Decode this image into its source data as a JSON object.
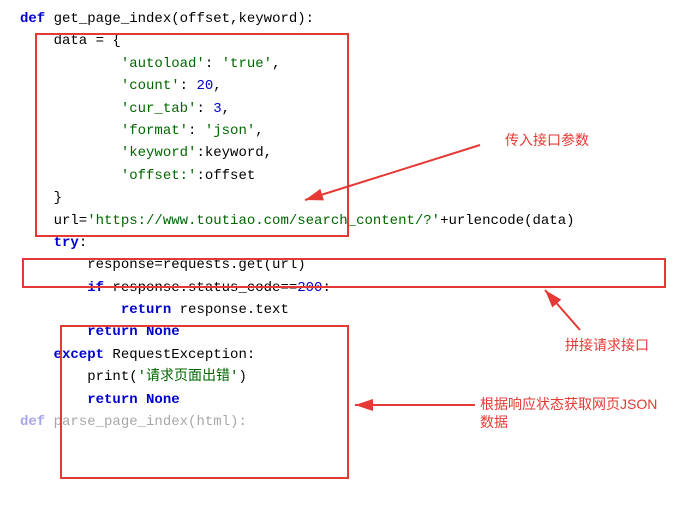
{
  "code": {
    "l1_def": "def",
    "l1_fn": " get_page_index",
    "l1_rest": "(offset,keyword):",
    "l2": "    data = {",
    "l3_k": "            'autoload'",
    "l3_sep": ": ",
    "l3_v": "'true'",
    "l3_end": ",",
    "l4_k": "            'count'",
    "l4_sep": ": ",
    "l4_v": "20",
    "l4_end": ",",
    "l5_k": "            'cur_tab'",
    "l5_sep": ": ",
    "l5_v": "3",
    "l5_end": ",",
    "l6_k": "            'format'",
    "l6_sep": ": ",
    "l6_v": "'json'",
    "l6_end": ",",
    "l7_k": "            'keyword'",
    "l7_rest": ":keyword,",
    "l8_k": "            'offset:'",
    "l8_rest": ":offset",
    "l9": "    }",
    "l10_a": "    url=",
    "l10_b": "'https://www.toutiao.com/search_content/?'",
    "l10_c": "+urlencode(data)",
    "l11_try": "    try",
    "l11_colon": ":",
    "l12": "        response=requests.get(url)",
    "l13_if": "        if",
    "l13_rest": " response.status_code==",
    "l13_num": "200",
    "l13_colon": ":",
    "l14_ret": "            return",
    "l14_rest": " response.text",
    "l15_ret": "        return",
    "l15_none": " None",
    "l16_exc": "    except",
    "l16_rest": " RequestException:",
    "l17_a": "        print(",
    "l17_b": "'请求页面出错'",
    "l17_c": ")",
    "l18_ret": "        return",
    "l18_none": " None",
    "l19_def": "def",
    "l19_fn": " parse_page_index",
    "l19_rest": "(html):"
  },
  "annotations": {
    "a1": "传入接口参数",
    "a2": "拼接请求接口",
    "a3_l1": "根据响应状态获取网页JSON",
    "a3_l2": "数据"
  }
}
